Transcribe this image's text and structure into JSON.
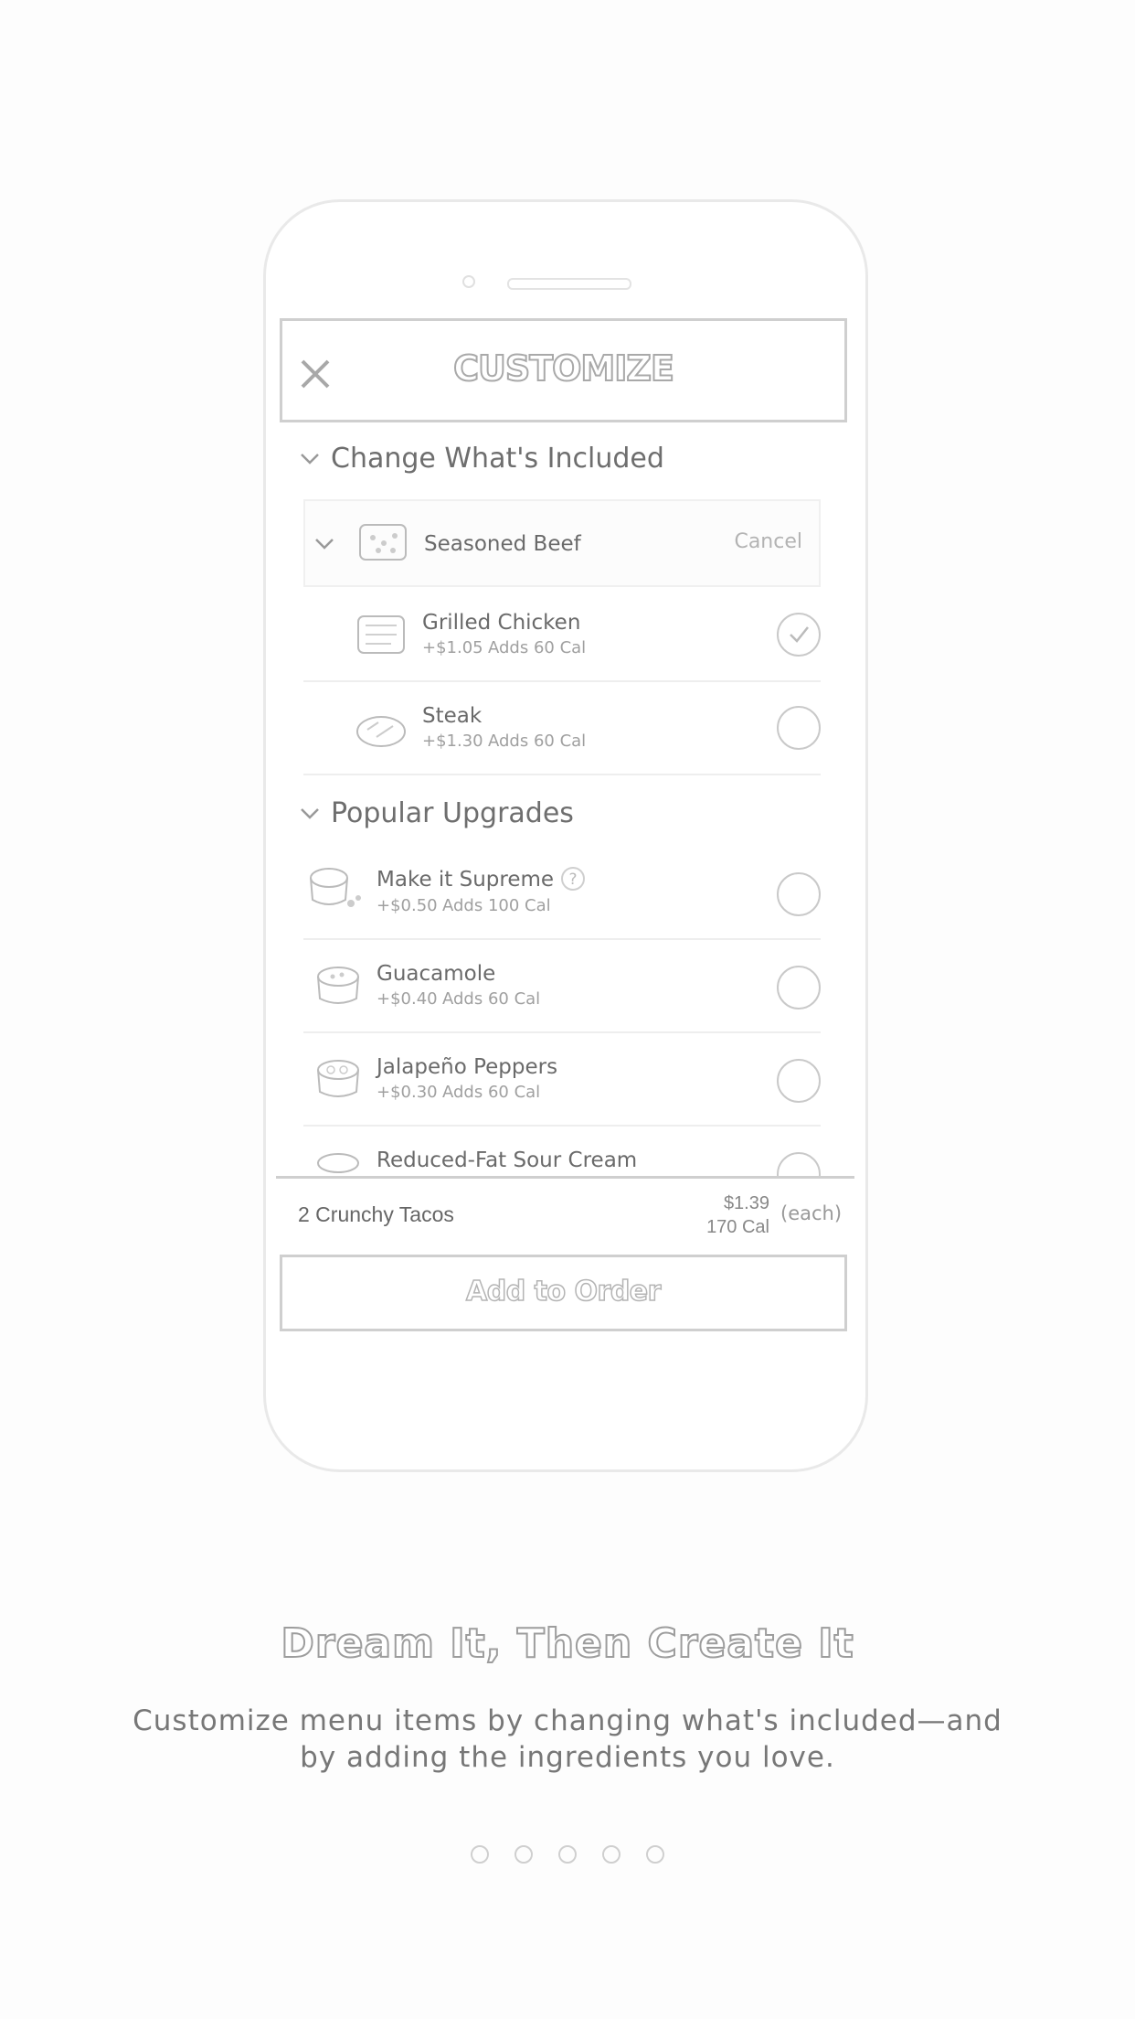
{
  "screen": {
    "title": "CUSTOMIZE",
    "sections": [
      {
        "title": "Change What's Included"
      },
      {
        "title": "Popular Upgrades"
      }
    ],
    "included": {
      "selected": {
        "name": "Seasoned Beef",
        "action": "Cancel"
      },
      "options": [
        {
          "name": "Grilled Chicken",
          "price": "+$1.05",
          "cal": "Adds 60 Cal",
          "checked": true
        },
        {
          "name": "Steak",
          "price": "+$1.30",
          "cal": "Adds 60 Cal",
          "checked": false
        }
      ]
    },
    "upgrades": [
      {
        "name": "Make it Supreme",
        "help": "?",
        "price": "+$0.50",
        "cal": "Adds 100 Cal"
      },
      {
        "name": "Guacamole",
        "price": "+$0.40",
        "cal": "Adds 60 Cal"
      },
      {
        "name": "Jalapeño Peppers",
        "price": "+$0.30",
        "cal": "Adds 60 Cal"
      },
      {
        "name": "Reduced-Fat Sour Cream"
      }
    ],
    "summary": {
      "qty_name": "2  Crunchy Tacos",
      "price": "$1.39",
      "cal": "170 Cal",
      "each": "(each)"
    },
    "add_button": "Add to Order"
  },
  "headline": "Dream It, Then Create It",
  "body": "Customize menu items by changing what's included—and by adding the ingredients you love.",
  "pager": {
    "total": 5
  }
}
